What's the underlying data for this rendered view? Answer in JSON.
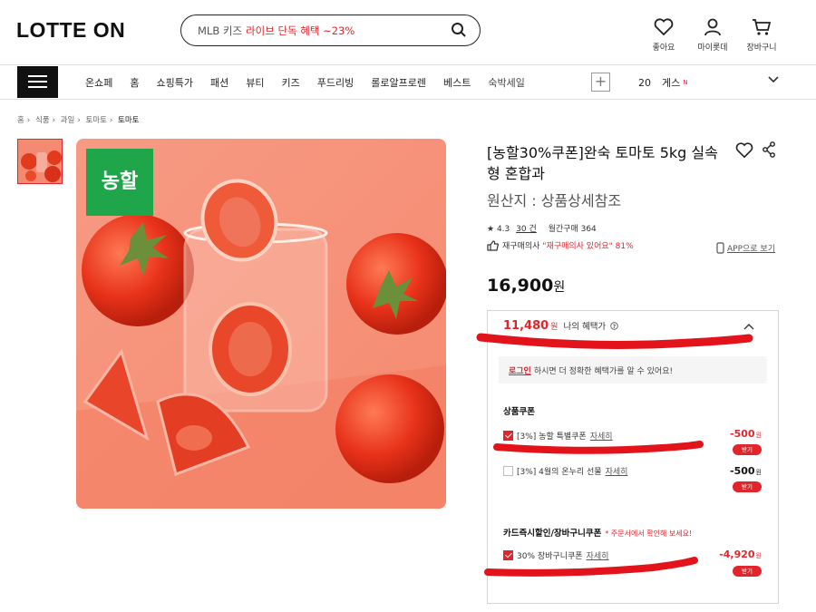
{
  "header": {
    "logo": "LOTTE ON",
    "search_prefix": "MLB 키즈",
    "search_highlight": "라이브 단독 혜택 ~23%",
    "icons": [
      {
        "name": "heart-icon",
        "label": "좋아요"
      },
      {
        "name": "user-icon",
        "label": "마이롯데"
      },
      {
        "name": "cart-icon",
        "label": "장바구니"
      }
    ]
  },
  "nav": {
    "items": [
      "온쇼페",
      "홈",
      "쇼핑특가",
      "패션",
      "뷰티",
      "키즈",
      "푸드리빙",
      "롤로알프로렌",
      "베스트",
      "숙박세일"
    ],
    "plus": "+",
    "rank_number": "20",
    "rank_keyword": "게스",
    "rank_badge": "N"
  },
  "breadcrumb": [
    "홈",
    "식품",
    "과일",
    "토마토",
    "토마토"
  ],
  "product": {
    "title": "[농할30%쿠폰]완숙 토마토 5kg 실속형 혼합과",
    "origin": "원산지 : 상품상세참조",
    "badge": "농할",
    "rating": "4.3",
    "review_count": "30 건",
    "monthly": "월간구매 364",
    "repurchase_label": "재구매의사",
    "repurchase_text": "\"재구매의사 있어요\" 81%",
    "app_view": "APP으로 보기",
    "price": "16,900",
    "price_unit": "원"
  },
  "benefit": {
    "price": "11,480",
    "unit": "원",
    "label": "나의 혜택가",
    "login_link": "로그인",
    "login_text": "하시면 더 정확한 혜택가를 알 수 있어요!",
    "product_coupon_title": "상품쿠폰",
    "coupons": [
      {
        "label": "[3%] 농할 특별쿠폰",
        "more": "자세히",
        "amount": "-500",
        "checked": true,
        "red": true,
        "button": "받기"
      },
      {
        "label": "[3%] 4월의 온누리 선물",
        "more": "자세히",
        "amount": "-500",
        "checked": false,
        "red": false,
        "button": "받기"
      }
    ],
    "card_title": "카드즉시할인/장바구니쿠폰",
    "card_note": "* 주문서에서 확인해 보세요!",
    "card_coupon": {
      "label": "30% 장바구니쿠폰",
      "more": "자세히",
      "amount": "-4,920",
      "checked": true,
      "button": "받기"
    },
    "won": "원"
  },
  "colors": {
    "accent": "#e2242b",
    "marker": "#e3131b",
    "badge_green": "#1fa64a"
  }
}
